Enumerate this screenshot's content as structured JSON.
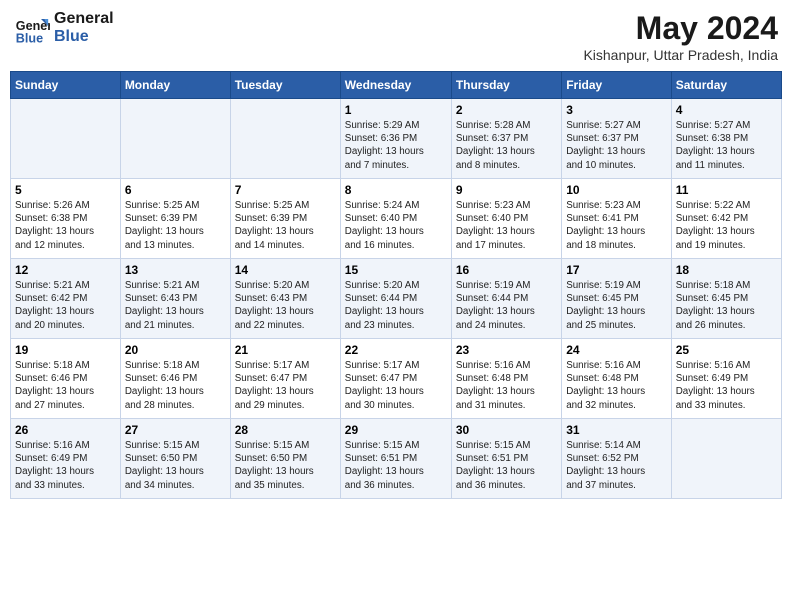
{
  "header": {
    "logo_line1": "General",
    "logo_line2": "Blue",
    "main_title": "May 2024",
    "subtitle": "Kishanpur, Uttar Pradesh, India"
  },
  "days_of_week": [
    "Sunday",
    "Monday",
    "Tuesday",
    "Wednesday",
    "Thursday",
    "Friday",
    "Saturday"
  ],
  "weeks": [
    [
      {
        "num": "",
        "content": ""
      },
      {
        "num": "",
        "content": ""
      },
      {
        "num": "",
        "content": ""
      },
      {
        "num": "1",
        "content": "Sunrise: 5:29 AM\nSunset: 6:36 PM\nDaylight: 13 hours\nand 7 minutes."
      },
      {
        "num": "2",
        "content": "Sunrise: 5:28 AM\nSunset: 6:37 PM\nDaylight: 13 hours\nand 8 minutes."
      },
      {
        "num": "3",
        "content": "Sunrise: 5:27 AM\nSunset: 6:37 PM\nDaylight: 13 hours\nand 10 minutes."
      },
      {
        "num": "4",
        "content": "Sunrise: 5:27 AM\nSunset: 6:38 PM\nDaylight: 13 hours\nand 11 minutes."
      }
    ],
    [
      {
        "num": "5",
        "content": "Sunrise: 5:26 AM\nSunset: 6:38 PM\nDaylight: 13 hours\nand 12 minutes."
      },
      {
        "num": "6",
        "content": "Sunrise: 5:25 AM\nSunset: 6:39 PM\nDaylight: 13 hours\nand 13 minutes."
      },
      {
        "num": "7",
        "content": "Sunrise: 5:25 AM\nSunset: 6:39 PM\nDaylight: 13 hours\nand 14 minutes."
      },
      {
        "num": "8",
        "content": "Sunrise: 5:24 AM\nSunset: 6:40 PM\nDaylight: 13 hours\nand 16 minutes."
      },
      {
        "num": "9",
        "content": "Sunrise: 5:23 AM\nSunset: 6:40 PM\nDaylight: 13 hours\nand 17 minutes."
      },
      {
        "num": "10",
        "content": "Sunrise: 5:23 AM\nSunset: 6:41 PM\nDaylight: 13 hours\nand 18 minutes."
      },
      {
        "num": "11",
        "content": "Sunrise: 5:22 AM\nSunset: 6:42 PM\nDaylight: 13 hours\nand 19 minutes."
      }
    ],
    [
      {
        "num": "12",
        "content": "Sunrise: 5:21 AM\nSunset: 6:42 PM\nDaylight: 13 hours\nand 20 minutes."
      },
      {
        "num": "13",
        "content": "Sunrise: 5:21 AM\nSunset: 6:43 PM\nDaylight: 13 hours\nand 21 minutes."
      },
      {
        "num": "14",
        "content": "Sunrise: 5:20 AM\nSunset: 6:43 PM\nDaylight: 13 hours\nand 22 minutes."
      },
      {
        "num": "15",
        "content": "Sunrise: 5:20 AM\nSunset: 6:44 PM\nDaylight: 13 hours\nand 23 minutes."
      },
      {
        "num": "16",
        "content": "Sunrise: 5:19 AM\nSunset: 6:44 PM\nDaylight: 13 hours\nand 24 minutes."
      },
      {
        "num": "17",
        "content": "Sunrise: 5:19 AM\nSunset: 6:45 PM\nDaylight: 13 hours\nand 25 minutes."
      },
      {
        "num": "18",
        "content": "Sunrise: 5:18 AM\nSunset: 6:45 PM\nDaylight: 13 hours\nand 26 minutes."
      }
    ],
    [
      {
        "num": "19",
        "content": "Sunrise: 5:18 AM\nSunset: 6:46 PM\nDaylight: 13 hours\nand 27 minutes."
      },
      {
        "num": "20",
        "content": "Sunrise: 5:18 AM\nSunset: 6:46 PM\nDaylight: 13 hours\nand 28 minutes."
      },
      {
        "num": "21",
        "content": "Sunrise: 5:17 AM\nSunset: 6:47 PM\nDaylight: 13 hours\nand 29 minutes."
      },
      {
        "num": "22",
        "content": "Sunrise: 5:17 AM\nSunset: 6:47 PM\nDaylight: 13 hours\nand 30 minutes."
      },
      {
        "num": "23",
        "content": "Sunrise: 5:16 AM\nSunset: 6:48 PM\nDaylight: 13 hours\nand 31 minutes."
      },
      {
        "num": "24",
        "content": "Sunrise: 5:16 AM\nSunset: 6:48 PM\nDaylight: 13 hours\nand 32 minutes."
      },
      {
        "num": "25",
        "content": "Sunrise: 5:16 AM\nSunset: 6:49 PM\nDaylight: 13 hours\nand 33 minutes."
      }
    ],
    [
      {
        "num": "26",
        "content": "Sunrise: 5:16 AM\nSunset: 6:49 PM\nDaylight: 13 hours\nand 33 minutes."
      },
      {
        "num": "27",
        "content": "Sunrise: 5:15 AM\nSunset: 6:50 PM\nDaylight: 13 hours\nand 34 minutes."
      },
      {
        "num": "28",
        "content": "Sunrise: 5:15 AM\nSunset: 6:50 PM\nDaylight: 13 hours\nand 35 minutes."
      },
      {
        "num": "29",
        "content": "Sunrise: 5:15 AM\nSunset: 6:51 PM\nDaylight: 13 hours\nand 36 minutes."
      },
      {
        "num": "30",
        "content": "Sunrise: 5:15 AM\nSunset: 6:51 PM\nDaylight: 13 hours\nand 36 minutes."
      },
      {
        "num": "31",
        "content": "Sunrise: 5:14 AM\nSunset: 6:52 PM\nDaylight: 13 hours\nand 37 minutes."
      },
      {
        "num": "",
        "content": ""
      }
    ]
  ]
}
